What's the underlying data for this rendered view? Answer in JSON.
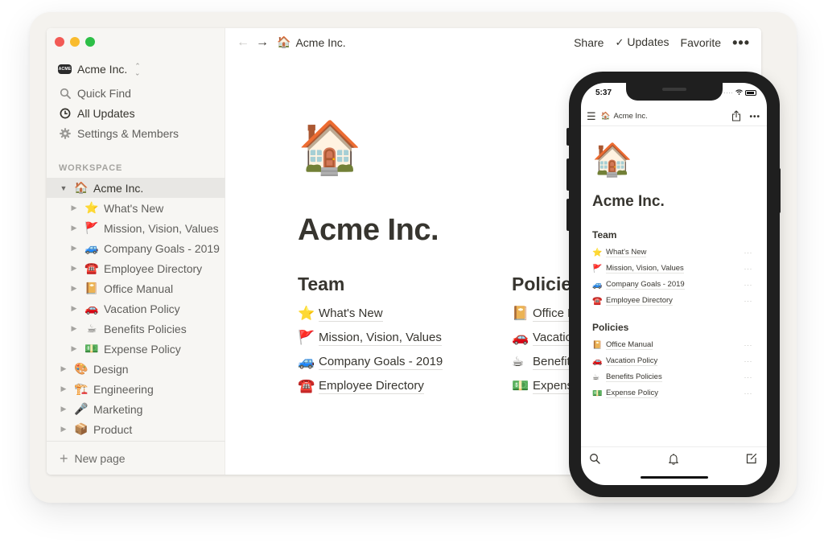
{
  "window": {
    "traffic_lights": [
      "close",
      "minimize",
      "zoom"
    ]
  },
  "sidebar": {
    "workspace_name": "Acme Inc.",
    "workspace_logo_text": "ACME",
    "nav": [
      {
        "label": "Quick Find",
        "icon": "search-icon"
      },
      {
        "label": "All Updates",
        "icon": "clock-icon",
        "active": true
      },
      {
        "label": "Settings & Members",
        "icon": "gear-icon"
      }
    ],
    "section_label": "WORKSPACE",
    "tree": [
      {
        "label": "Acme Inc.",
        "emoji": "🏠",
        "level": 0,
        "expanded": true,
        "selected": true
      },
      {
        "label": "What's New",
        "emoji": "⭐",
        "level": 1
      },
      {
        "label": "Mission, Vision, Values",
        "emoji": "🚩",
        "level": 1
      },
      {
        "label": "Company Goals - 2019",
        "emoji": "🚙",
        "level": 1
      },
      {
        "label": "Employee Directory",
        "emoji": "☎️",
        "level": 1
      },
      {
        "label": "Office Manual",
        "emoji": "📔",
        "level": 1
      },
      {
        "label": "Vacation Policy",
        "emoji": "🚗",
        "level": 1
      },
      {
        "label": "Benefits Policies",
        "emoji": "☕",
        "level": 1
      },
      {
        "label": "Expense Policy",
        "emoji": "💵",
        "level": 1
      },
      {
        "label": "Design",
        "emoji": "🎨",
        "level": 0
      },
      {
        "label": "Engineering",
        "emoji": "🏗️",
        "level": 0
      },
      {
        "label": "Marketing",
        "emoji": "🎤",
        "level": 0
      },
      {
        "label": "Product",
        "emoji": "📦",
        "level": 0
      }
    ],
    "new_page_label": "New page"
  },
  "topbar": {
    "breadcrumb_emoji": "🏠",
    "breadcrumb": "Acme Inc.",
    "share_label": "Share",
    "updates_label": "Updates",
    "favorite_label": "Favorite",
    "more_label": "•••"
  },
  "page": {
    "icon": "🏠",
    "title": "Acme Inc.",
    "team": {
      "heading": "Team",
      "links": [
        {
          "emoji": "⭐",
          "label": "What's New"
        },
        {
          "emoji": "🚩",
          "label": "Mission, Vision, Values"
        },
        {
          "emoji": "🚙",
          "label": "Company Goals - 2019"
        },
        {
          "emoji": "☎️",
          "label": "Employee Directory"
        }
      ]
    },
    "policies": {
      "heading": "Policies",
      "links": [
        {
          "emoji": "📔",
          "label": "Office Manual"
        },
        {
          "emoji": "🚗",
          "label": "Vacation Policy"
        },
        {
          "emoji": "☕",
          "label": "Benefits Policies"
        },
        {
          "emoji": "💵",
          "label": "Expense Policy"
        }
      ]
    }
  },
  "phone": {
    "time": "5:37",
    "signal": "·····",
    "breadcrumb_emoji": "🏠",
    "breadcrumb": "Acme Inc.",
    "more_label": "•••",
    "page_icon": "🏠",
    "page_title": "Acme Inc.",
    "row_more": "···",
    "team": {
      "heading": "Team",
      "links": [
        {
          "emoji": "⭐",
          "label": "What's New"
        },
        {
          "emoji": "🚩",
          "label": "Mission, Vision, Values"
        },
        {
          "emoji": "🚙",
          "label": "Company Goals - 2019"
        },
        {
          "emoji": "☎️",
          "label": "Employee Directory"
        }
      ]
    },
    "policies": {
      "heading": "Policies",
      "links": [
        {
          "emoji": "📔",
          "label": "Office Manual"
        },
        {
          "emoji": "🚗",
          "label": "Vacation Policy"
        },
        {
          "emoji": "☕",
          "label": "Benefits Policies"
        },
        {
          "emoji": "💵",
          "label": "Expense Policy"
        }
      ]
    },
    "tabs": [
      "search-icon",
      "bell-icon",
      "compose-icon"
    ]
  }
}
